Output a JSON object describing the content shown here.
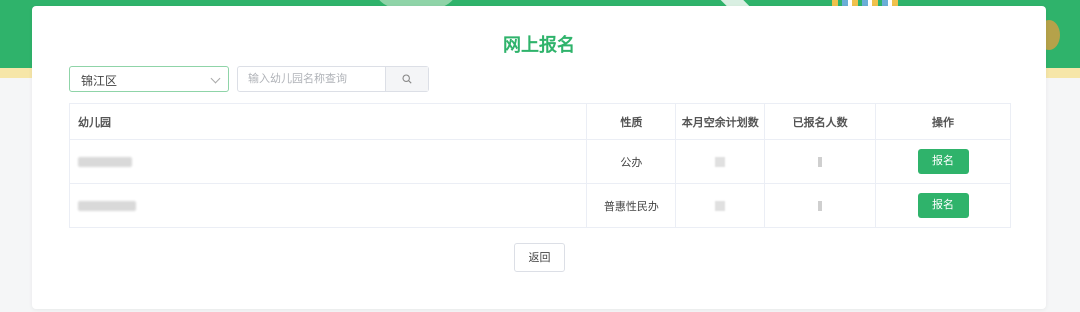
{
  "page": {
    "title": "网上报名"
  },
  "filters": {
    "district": "锦江区",
    "search_placeholder": "输入幼儿园名称查询",
    "search_icon": "search-icon"
  },
  "table": {
    "headers": [
      "幼儿园",
      "性质",
      "本月空余计划数",
      "已报名人数",
      "操作"
    ],
    "rows": [
      {
        "nature": "公办",
        "action": "报名"
      },
      {
        "nature": "普惠性民办",
        "action": "报名"
      }
    ]
  },
  "footer": {
    "back_label": "返回"
  },
  "colors": {
    "brand": "#2fb36b",
    "banner_stripe": "#f6e6a8"
  }
}
